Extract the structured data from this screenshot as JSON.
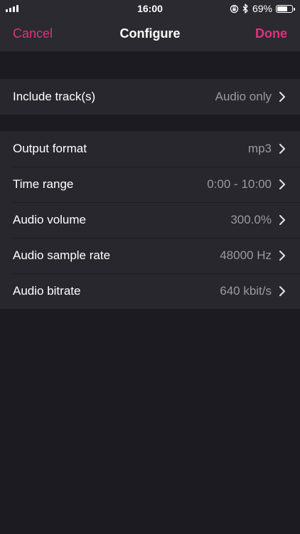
{
  "status_bar": {
    "time": "16:00",
    "battery_percent": "69%",
    "battery_level": 0.69,
    "icons": [
      "signal-icon",
      "orientation-lock-icon",
      "bluetooth-icon",
      "battery-icon"
    ]
  },
  "nav": {
    "cancel_label": "Cancel",
    "title": "Configure",
    "done_label": "Done"
  },
  "colors": {
    "accent": "#e4307d",
    "background": "#1c1b21",
    "cell": "#28272d",
    "secondary_text": "#9a999f"
  },
  "tracks": {
    "label": "Include track(s)",
    "value": "Audio only"
  },
  "settings": [
    {
      "label": "Output format",
      "value": "mp3"
    },
    {
      "label": "Time range",
      "value": "0:00 - 10:00"
    },
    {
      "label": "Audio volume",
      "value": "300.0%"
    },
    {
      "label": "Audio sample rate",
      "value": "48000 Hz"
    },
    {
      "label": "Audio bitrate",
      "value": "640 kbit/s"
    }
  ]
}
